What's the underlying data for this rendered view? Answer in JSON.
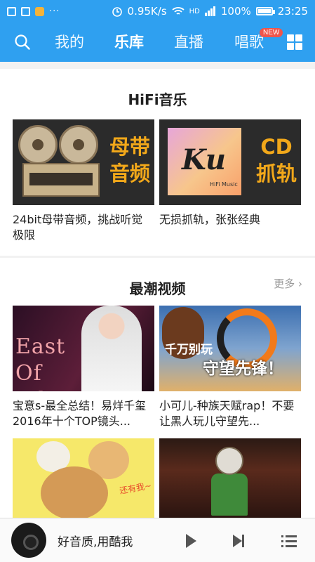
{
  "status_bar": {
    "speed": "0.95K/s",
    "network": "HD",
    "battery": "100%",
    "time": "23:25",
    "overflow": "···"
  },
  "nav": {
    "tabs": [
      {
        "label": "我的"
      },
      {
        "label": "乐库"
      },
      {
        "label": "直播"
      },
      {
        "label": "唱歌"
      }
    ],
    "active_tab": "乐库",
    "new_badge": "NEW"
  },
  "hifi": {
    "title": "HiFi音乐",
    "items": [
      {
        "thumb_text": [
          "母带",
          "音频"
        ],
        "caption": "24bit母带音频，挑战听觉极限"
      },
      {
        "thumb_text": [
          "CD",
          "抓轨"
        ],
        "logo": "Ku",
        "logo_sub": "HiFi Music",
        "caption": "无损抓轨，张张经典"
      }
    ]
  },
  "videos": {
    "title": "最潮视频",
    "more": "更多 ›",
    "items": [
      {
        "thumb_text": "East Of Eden",
        "caption": "宝意s-最全总结！易烊千玺2016年十个TOP镜头..."
      },
      {
        "thumb_text": [
          "千万别玩",
          "守望先锋！"
        ],
        "caption": "小可儿-种族天赋rap！不要让黑人玩儿守望先..."
      },
      {
        "thumb_text": "还有我~",
        "caption": ""
      },
      {
        "thumb_text": "",
        "caption": ""
      }
    ]
  },
  "player": {
    "title": "好音质,用酷我"
  },
  "colors": {
    "brand_blue": "#2fa0f0",
    "accent_orange": "#f2a81a",
    "badge_red": "#f0554b"
  }
}
